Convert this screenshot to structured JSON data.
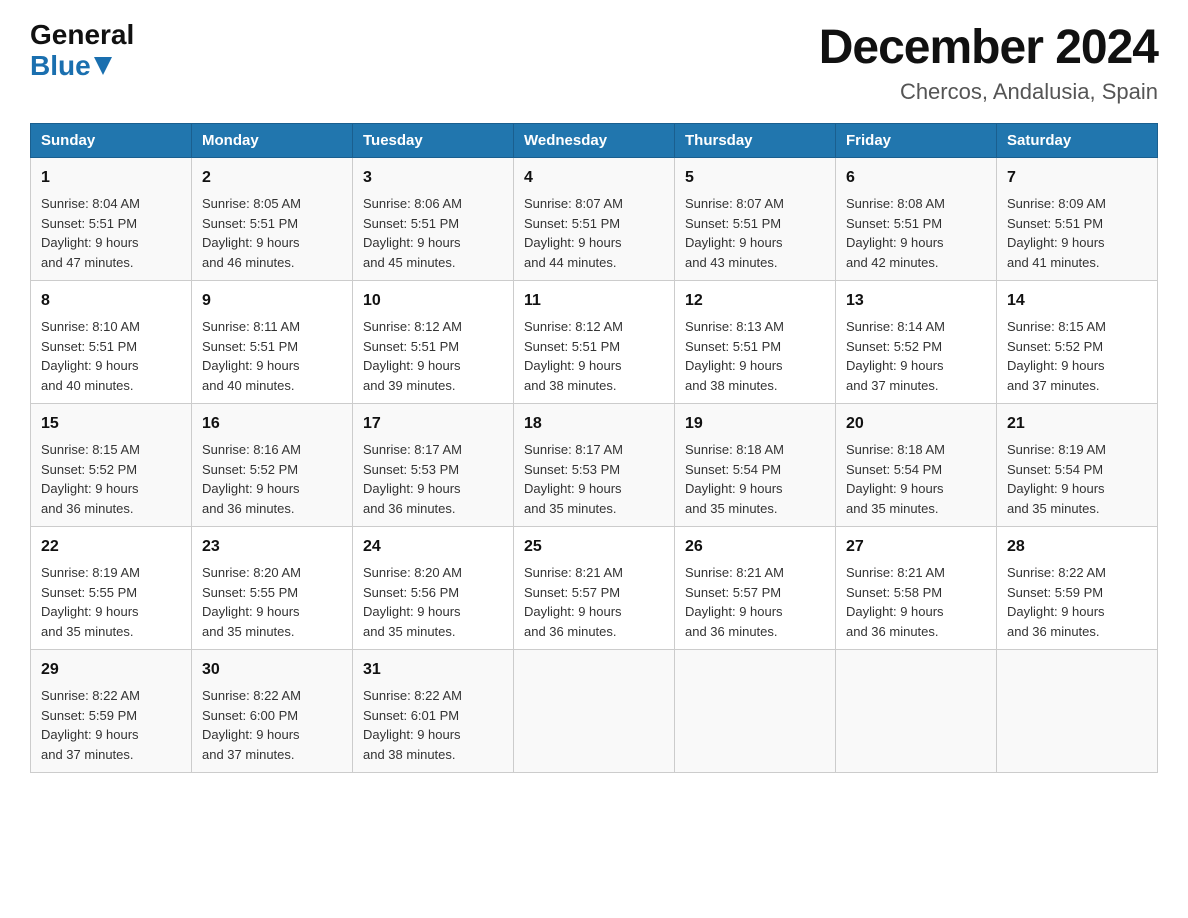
{
  "header": {
    "logo_general": "General",
    "logo_blue": "Blue",
    "month_title": "December 2024",
    "location": "Chercos, Andalusia, Spain"
  },
  "weekdays": [
    "Sunday",
    "Monday",
    "Tuesday",
    "Wednesday",
    "Thursday",
    "Friday",
    "Saturday"
  ],
  "weeks": [
    [
      {
        "day": "1",
        "sunrise": "8:04 AM",
        "sunset": "5:51 PM",
        "daylight": "9 hours and 47 minutes."
      },
      {
        "day": "2",
        "sunrise": "8:05 AM",
        "sunset": "5:51 PM",
        "daylight": "9 hours and 46 minutes."
      },
      {
        "day": "3",
        "sunrise": "8:06 AM",
        "sunset": "5:51 PM",
        "daylight": "9 hours and 45 minutes."
      },
      {
        "day": "4",
        "sunrise": "8:07 AM",
        "sunset": "5:51 PM",
        "daylight": "9 hours and 44 minutes."
      },
      {
        "day": "5",
        "sunrise": "8:07 AM",
        "sunset": "5:51 PM",
        "daylight": "9 hours and 43 minutes."
      },
      {
        "day": "6",
        "sunrise": "8:08 AM",
        "sunset": "5:51 PM",
        "daylight": "9 hours and 42 minutes."
      },
      {
        "day": "7",
        "sunrise": "8:09 AM",
        "sunset": "5:51 PM",
        "daylight": "9 hours and 41 minutes."
      }
    ],
    [
      {
        "day": "8",
        "sunrise": "8:10 AM",
        "sunset": "5:51 PM",
        "daylight": "9 hours and 40 minutes."
      },
      {
        "day": "9",
        "sunrise": "8:11 AM",
        "sunset": "5:51 PM",
        "daylight": "9 hours and 40 minutes."
      },
      {
        "day": "10",
        "sunrise": "8:12 AM",
        "sunset": "5:51 PM",
        "daylight": "9 hours and 39 minutes."
      },
      {
        "day": "11",
        "sunrise": "8:12 AM",
        "sunset": "5:51 PM",
        "daylight": "9 hours and 38 minutes."
      },
      {
        "day": "12",
        "sunrise": "8:13 AM",
        "sunset": "5:51 PM",
        "daylight": "9 hours and 38 minutes."
      },
      {
        "day": "13",
        "sunrise": "8:14 AM",
        "sunset": "5:52 PM",
        "daylight": "9 hours and 37 minutes."
      },
      {
        "day": "14",
        "sunrise": "8:15 AM",
        "sunset": "5:52 PM",
        "daylight": "9 hours and 37 minutes."
      }
    ],
    [
      {
        "day": "15",
        "sunrise": "8:15 AM",
        "sunset": "5:52 PM",
        "daylight": "9 hours and 36 minutes."
      },
      {
        "day": "16",
        "sunrise": "8:16 AM",
        "sunset": "5:52 PM",
        "daylight": "9 hours and 36 minutes."
      },
      {
        "day": "17",
        "sunrise": "8:17 AM",
        "sunset": "5:53 PM",
        "daylight": "9 hours and 36 minutes."
      },
      {
        "day": "18",
        "sunrise": "8:17 AM",
        "sunset": "5:53 PM",
        "daylight": "9 hours and 35 minutes."
      },
      {
        "day": "19",
        "sunrise": "8:18 AM",
        "sunset": "5:54 PM",
        "daylight": "9 hours and 35 minutes."
      },
      {
        "day": "20",
        "sunrise": "8:18 AM",
        "sunset": "5:54 PM",
        "daylight": "9 hours and 35 minutes."
      },
      {
        "day": "21",
        "sunrise": "8:19 AM",
        "sunset": "5:54 PM",
        "daylight": "9 hours and 35 minutes."
      }
    ],
    [
      {
        "day": "22",
        "sunrise": "8:19 AM",
        "sunset": "5:55 PM",
        "daylight": "9 hours and 35 minutes."
      },
      {
        "day": "23",
        "sunrise": "8:20 AM",
        "sunset": "5:55 PM",
        "daylight": "9 hours and 35 minutes."
      },
      {
        "day": "24",
        "sunrise": "8:20 AM",
        "sunset": "5:56 PM",
        "daylight": "9 hours and 35 minutes."
      },
      {
        "day": "25",
        "sunrise": "8:21 AM",
        "sunset": "5:57 PM",
        "daylight": "9 hours and 36 minutes."
      },
      {
        "day": "26",
        "sunrise": "8:21 AM",
        "sunset": "5:57 PM",
        "daylight": "9 hours and 36 minutes."
      },
      {
        "day": "27",
        "sunrise": "8:21 AM",
        "sunset": "5:58 PM",
        "daylight": "9 hours and 36 minutes."
      },
      {
        "day": "28",
        "sunrise": "8:22 AM",
        "sunset": "5:59 PM",
        "daylight": "9 hours and 36 minutes."
      }
    ],
    [
      {
        "day": "29",
        "sunrise": "8:22 AM",
        "sunset": "5:59 PM",
        "daylight": "9 hours and 37 minutes."
      },
      {
        "day": "30",
        "sunrise": "8:22 AM",
        "sunset": "6:00 PM",
        "daylight": "9 hours and 37 minutes."
      },
      {
        "day": "31",
        "sunrise": "8:22 AM",
        "sunset": "6:01 PM",
        "daylight": "9 hours and 38 minutes."
      },
      null,
      null,
      null,
      null
    ]
  ]
}
